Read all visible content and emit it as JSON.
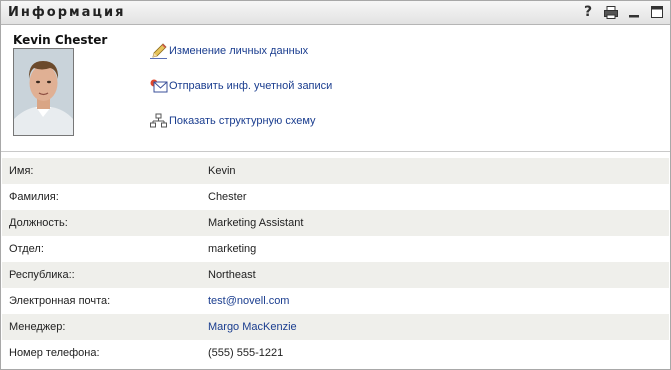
{
  "window": {
    "title": "Информация",
    "icons": [
      "help-icon",
      "print-icon",
      "minimize-icon",
      "maximize-icon"
    ]
  },
  "profile": {
    "name": "Kevin Chester"
  },
  "actions": [
    {
      "label": "Изменение личных данных",
      "icon": "pencil-icon"
    },
    {
      "label": "Отправить инф. учетной записи",
      "icon": "send-mail-icon"
    },
    {
      "label": "Показать структурную схему",
      "icon": "org-chart-icon"
    }
  ],
  "details": [
    {
      "label": "Имя:",
      "value": "Kevin",
      "link": false
    },
    {
      "label": "Фамилия:",
      "value": "Chester",
      "link": false
    },
    {
      "label": "Должность:",
      "value": "Marketing Assistant",
      "link": false
    },
    {
      "label": "Отдел:",
      "value": "marketing",
      "link": false
    },
    {
      "label": "Республика::",
      "value": "Northeast",
      "link": false
    },
    {
      "label": "Электронная почта:",
      "value": "test@novell.com",
      "link": true
    },
    {
      "label": "Менеджер:",
      "value": "Margo MacKenzie",
      "link": true
    },
    {
      "label": "Номер телефона:",
      "value": "(555) 555-1221",
      "link": false
    }
  ],
  "colors": {
    "link": "#1a3d8f",
    "row_alt": "#efefeb"
  }
}
